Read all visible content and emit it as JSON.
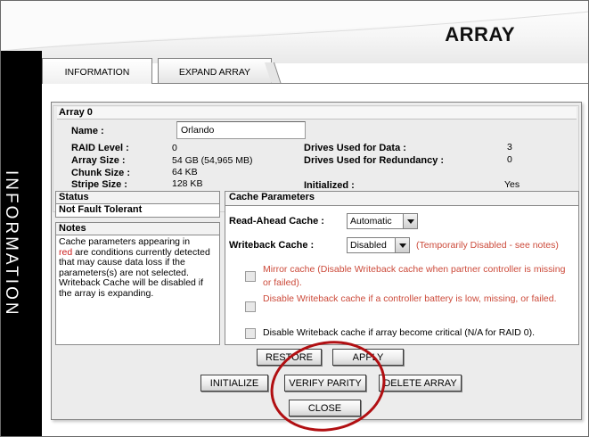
{
  "header": {
    "title": "ARRAY"
  },
  "sidebar": {
    "label": "INFORMATION"
  },
  "tabs": [
    {
      "label": "INFORMATION"
    },
    {
      "label": "EXPAND ARRAY"
    }
  ],
  "array": {
    "title": "Array 0",
    "name_label": "Name :",
    "name_value": "Orlando",
    "raid_level_label": "RAID Level :",
    "raid_level_value": "0",
    "array_size_label": "Array Size :",
    "array_size_value": "54 GB (54,965 MB)",
    "chunk_size_label": "Chunk Size :",
    "chunk_size_value": "64 KB",
    "stripe_size_label": "Stripe Size :",
    "stripe_size_value": "128 KB",
    "drives_data_label": "Drives Used for Data :",
    "drives_data_value": "3",
    "drives_redundancy_label": "Drives Used for Redundancy :",
    "drives_redundancy_value": "0",
    "initialized_label": "Initialized :",
    "initialized_value": "Yes"
  },
  "status": {
    "heading": "Status",
    "value": "Not Fault Tolerant"
  },
  "notes": {
    "heading": "Notes",
    "text_a": "Cache parameters appearing in",
    "text_red": "red",
    "text_b": " are conditions currently detected that may cause data loss if the parameters(s) are not selected.",
    "text_c": "Writeback Cache will be disabled if the array is expanding."
  },
  "cache": {
    "heading": "Cache Parameters",
    "read_ahead_label": "Read-Ahead Cache :",
    "read_ahead_value": "Automatic",
    "writeback_label": "Writeback Cache :",
    "writeback_value": "Disabled",
    "writeback_note": "(Temporarily Disabled - see notes)",
    "option_1": "Mirror cache (Disable Writeback cache when partner controller is missing or failed).",
    "option_2": "Disable Writeback cache if a controller battery is low, missing, or failed.",
    "option_3": "Disable Writeback cache if array become critical (N/A for RAID 0)."
  },
  "buttons": {
    "restore": "RESTORE",
    "apply": "APPLY",
    "initialize": "INITIALIZE",
    "verify_parity": "VERIFY PARITY",
    "delete_array": "DELETE ARRAY",
    "close": "CLOSE"
  },
  "colors": {
    "sidebar": "#000000",
    "warning_red": "#cc1b1b",
    "annotation_circle": "#b10f12"
  }
}
